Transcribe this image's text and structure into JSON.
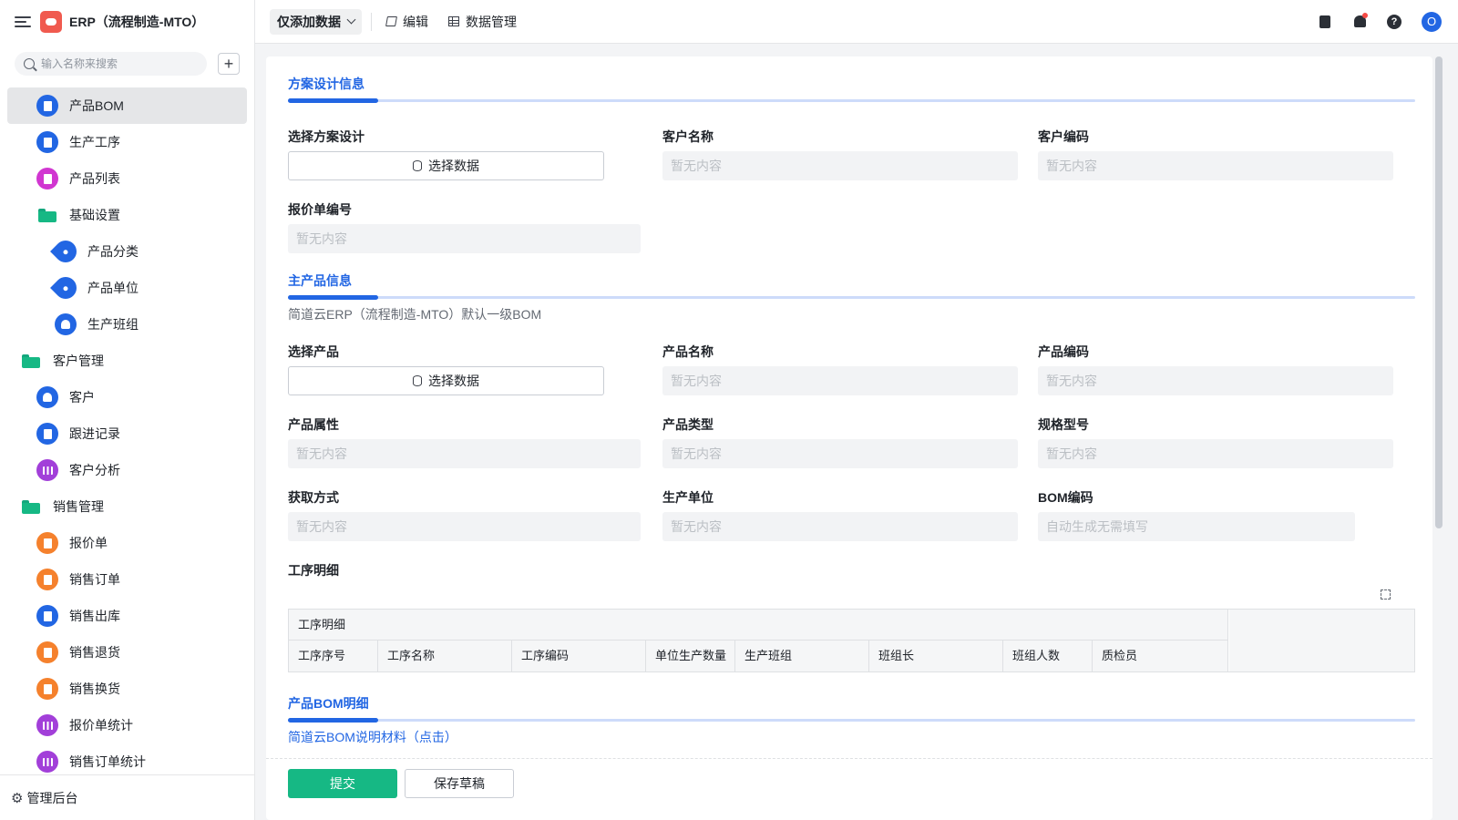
{
  "app": {
    "title": "ERP（流程制造-MTO）"
  },
  "sidebar": {
    "search_placeholder": "输入名称来搜索",
    "items": [
      {
        "label": "产品BOM",
        "level": 1,
        "type": "page",
        "icon": "document-icon",
        "color": "#2266e3",
        "active": true
      },
      {
        "label": "生产工序",
        "level": 1,
        "type": "page",
        "icon": "document-icon",
        "color": "#2266e3"
      },
      {
        "label": "产品列表",
        "level": 1,
        "type": "page",
        "icon": "list-icon",
        "color": "#d136d1"
      },
      {
        "label": "基础设置",
        "level": 1,
        "type": "folder",
        "icon": "folder-icon",
        "color": "#16b884"
      },
      {
        "label": "产品分类",
        "level": 2,
        "type": "page",
        "icon": "tag-icon",
        "color": "#2266e3"
      },
      {
        "label": "产品单位",
        "level": 2,
        "type": "page",
        "icon": "tag-icon",
        "color": "#2266e3"
      },
      {
        "label": "生产班组",
        "level": 2,
        "type": "page",
        "icon": "person-icon",
        "color": "#2266e3"
      },
      {
        "label": "客户管理",
        "level": 0,
        "type": "folder",
        "icon": "folder-icon",
        "color": "#16b884"
      },
      {
        "label": "客户",
        "level": 1,
        "type": "page",
        "icon": "person-icon",
        "color": "#2266e3"
      },
      {
        "label": "跟进记录",
        "level": 1,
        "type": "page",
        "icon": "inbox-icon",
        "color": "#2266e3"
      },
      {
        "label": "客户分析",
        "level": 1,
        "type": "page",
        "icon": "chart-icon",
        "color": "#a23fd9"
      },
      {
        "label": "销售管理",
        "level": 0,
        "type": "folder",
        "icon": "folder-icon",
        "color": "#16b884"
      },
      {
        "label": "报价单",
        "level": 1,
        "type": "page",
        "icon": "document-icon",
        "color": "#f5812d"
      },
      {
        "label": "销售订单",
        "level": 1,
        "type": "page",
        "icon": "document-icon",
        "color": "#f5812d"
      },
      {
        "label": "销售出库",
        "level": 1,
        "type": "page",
        "icon": "document-icon",
        "color": "#2266e3"
      },
      {
        "label": "销售退货",
        "level": 1,
        "type": "page",
        "icon": "document-icon",
        "color": "#f5812d"
      },
      {
        "label": "销售换货",
        "level": 1,
        "type": "page",
        "icon": "document-icon",
        "color": "#f5812d"
      },
      {
        "label": "报价单统计",
        "level": 1,
        "type": "page",
        "icon": "chart-icon",
        "color": "#a23fd9"
      },
      {
        "label": "销售订单统计",
        "level": 1,
        "type": "page",
        "icon": "chart-icon",
        "color": "#a23fd9"
      }
    ],
    "footer_label": "管理后台"
  },
  "toolbar": {
    "mode_label": "仅添加数据",
    "edit_label": "编辑",
    "data_manage_label": "数据管理",
    "avatar_initial": "O",
    "help_glyph": "?"
  },
  "form": {
    "empty_text": "暂无内容",
    "select_data_label": "选择数据",
    "section_scheme": {
      "title": "方案设计信息",
      "fields": {
        "scheme": "选择方案设计",
        "customer_name": "客户名称",
        "customer_code": "客户编码",
        "quote_no": "报价单编号"
      }
    },
    "section_product": {
      "title": "主产品信息",
      "desc": "简道云ERP（流程制造-MTO）默认一级BOM",
      "fields": {
        "select_product": "选择产品",
        "product_name": "产品名称",
        "product_code": "产品编码",
        "product_attr": "产品属性",
        "product_type": "产品类型",
        "spec_model": "规格型号",
        "acquire_method": "获取方式",
        "production_unit": "生产单位",
        "bom_code": "BOM编码",
        "bom_code_placeholder": "自动生成无需填写"
      }
    },
    "process_detail": {
      "label": "工序明细",
      "group_header": "工序明细",
      "columns": [
        "工序序号",
        "工序名称",
        "工序编码",
        "单位生产数量",
        "生产班组",
        "班组长",
        "班组人数",
        "质检员"
      ]
    },
    "section_bom": {
      "title": "产品BOM明细",
      "link": "简道云BOM说明材料（点击）"
    }
  },
  "actions": {
    "submit": "提交",
    "save_draft": "保存草稿"
  },
  "colors": {
    "accent": "#2266e3",
    "submit": "#16b884",
    "logo": "#f05a4f"
  }
}
